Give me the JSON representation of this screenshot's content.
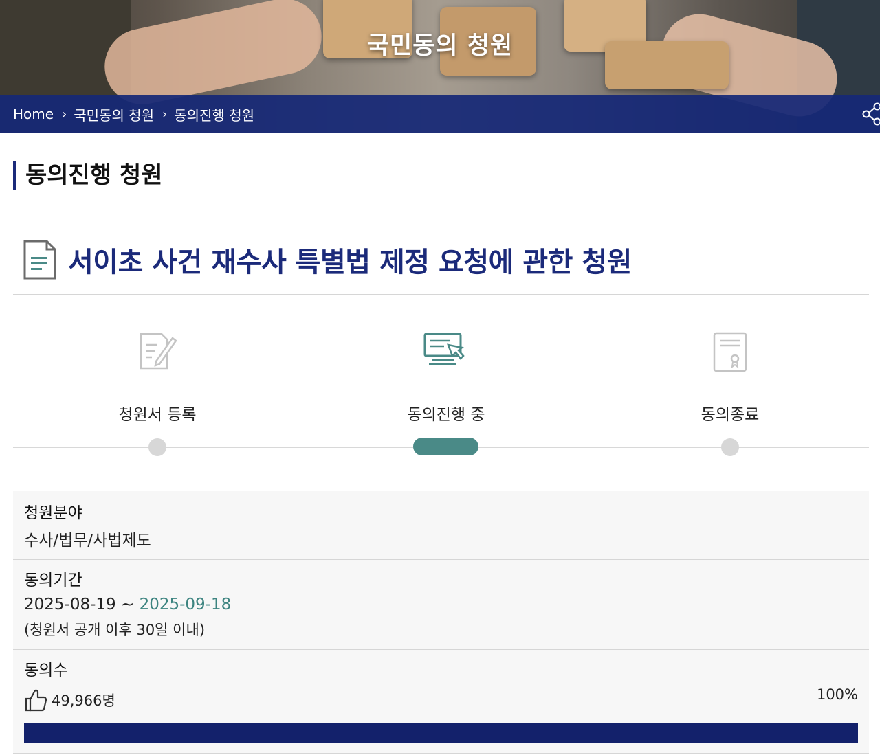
{
  "hero": {
    "title": "국민동의 청원"
  },
  "breadcrumb": {
    "items": [
      "Home",
      "국민동의 청원",
      "동의진행 청원"
    ]
  },
  "section_title": "동의진행 청원",
  "petition": {
    "title": "서이초 사건 재수사 특별법 제정 요청에 관한 청원"
  },
  "steps": [
    {
      "label": "청원서 등록",
      "icon": "petition-write-icon",
      "active": false
    },
    {
      "label": "동의진행 중",
      "icon": "online-consent-icon",
      "active": true
    },
    {
      "label": "동의종료",
      "icon": "certificate-icon",
      "active": false
    }
  ],
  "info": {
    "field": {
      "label": "청원분야",
      "value": "수사/법무/사법제도"
    },
    "period": {
      "label": "동의기간",
      "start": "2025-08-19",
      "separator": "~",
      "end": "2025-09-18",
      "note": "(청원서 공개 이후 30일 이내)"
    },
    "count": {
      "label": "동의수",
      "value": "49,966명",
      "percent_text": "100%",
      "progress": 1.0
    }
  },
  "colors": {
    "brand_navy": "#1b2a7a",
    "progress_fill": "#13216b",
    "accent_teal": "#4a8a87"
  }
}
